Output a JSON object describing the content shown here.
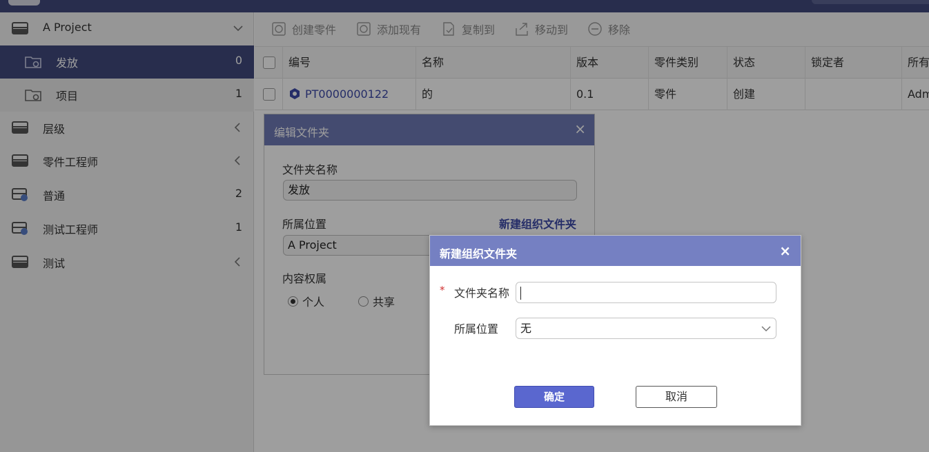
{
  "sidebar": {
    "items": [
      {
        "label": "A Project",
        "count": "",
        "icon": "drawer-icon"
      },
      {
        "label": "发放",
        "count": "0",
        "icon": "folder-gear-icon"
      },
      {
        "label": "项目",
        "count": "1",
        "icon": "folder-gear-icon"
      },
      {
        "label": "层级",
        "count": "",
        "icon": "drawer-icon"
      },
      {
        "label": "零件工程师",
        "count": "",
        "icon": "drawer-icon"
      },
      {
        "label": "普通",
        "count": "2",
        "icon": "drawer-gear-icon"
      },
      {
        "label": "测试工程师",
        "count": "1",
        "icon": "drawer-gear-icon"
      },
      {
        "label": "测试",
        "count": "",
        "icon": "drawer-icon"
      }
    ]
  },
  "toolbar": {
    "create_part": "创建零件",
    "add_existing": "添加现有",
    "copy_to": "复制到",
    "move_to": "移动到",
    "remove": "移除"
  },
  "table": {
    "columns": [
      "编号",
      "名称",
      "版本",
      "零件类别",
      "状态",
      "锁定者",
      "所有"
    ],
    "rows": [
      {
        "number": "PT0000000122",
        "name": "的",
        "version": "0.1",
        "category": "零件",
        "status": "创建",
        "locked_by": "",
        "owner": "Adm"
      }
    ]
  },
  "edit_dialog": {
    "title": "编辑文件夹",
    "close": "×",
    "name_label": "文件夹名称",
    "name_value": "发放",
    "location_label": "所属位置",
    "new_org_link": "新建组织文件夹",
    "location_value": "A Project",
    "perm_label": "内容权属",
    "perm_options": [
      "个人",
      "共享"
    ],
    "perm_selected": "个人"
  },
  "new_dialog": {
    "title": "新建组织文件夹",
    "close": "×",
    "required_mark": "*",
    "name_label": "文件夹名称",
    "name_value": "",
    "location_label": "所属位置",
    "location_value": "无",
    "ok": "确定",
    "cancel": "取消"
  },
  "colors": {
    "topbar": "#424a7d",
    "active_item": "#424a7d",
    "dialog_header": "#7580c2",
    "primary_button": "#5a67cf",
    "link": "#3d4aa8"
  }
}
